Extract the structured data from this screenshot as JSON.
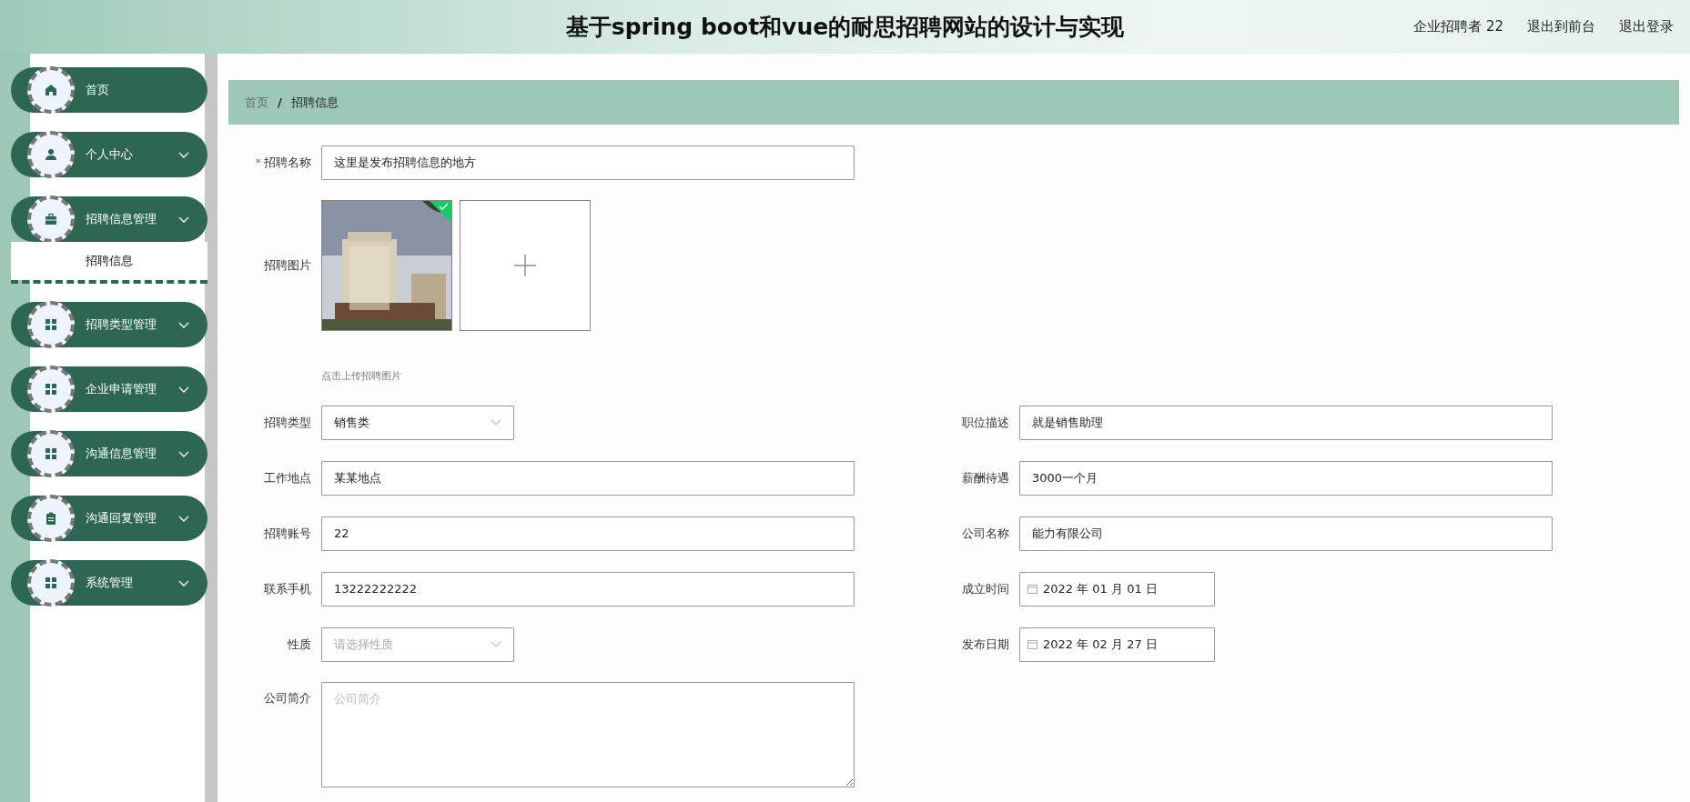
{
  "header": {
    "title": "基于spring boot和vue的耐思招聘网站的设计与实现",
    "links": [
      {
        "label": "企业招聘者 22"
      },
      {
        "label": "退出到前台"
      },
      {
        "label": "退出登录"
      }
    ]
  },
  "sidebar": {
    "items": [
      {
        "label": "首页",
        "kind": "link"
      },
      {
        "label": "个人中心",
        "kind": "menu"
      },
      {
        "label": "招聘信息管理",
        "kind": "menu",
        "children": [
          {
            "label": "招聘信息",
            "selected": true
          }
        ]
      },
      {
        "label": "招聘类型管理",
        "kind": "menu"
      },
      {
        "label": "企业申请管理",
        "kind": "menu"
      },
      {
        "label": "沟通信息管理",
        "kind": "menu"
      },
      {
        "label": "沟通回复管理",
        "kind": "menu"
      },
      {
        "label": "系统管理",
        "kind": "menu"
      }
    ]
  },
  "breadcrumb": {
    "separator": "/",
    "items": [
      {
        "label": "首页",
        "selected": false
      },
      {
        "label": "招聘信息",
        "selected": true
      }
    ]
  },
  "form": {
    "top_fields": [
      {
        "kind": "text",
        "label": "招聘名称",
        "required_mark": "*",
        "value": "这里是发布招聘信息的地方"
      },
      {
        "kind": "upload",
        "label": "招聘图片",
        "images": [
          {
            "kind": "picture",
            "uploaded": true
          }
        ],
        "hint": "点击上传招聘图片"
      }
    ],
    "grid_fields": [
      {
        "kind": "select",
        "label": "招聘类型",
        "value": "销售类"
      },
      {
        "kind": "text",
        "label": "职位描述",
        "value": "就是销售助理"
      },
      {
        "kind": "text",
        "label": "工作地点",
        "value": "某某地点"
      },
      {
        "kind": "text",
        "label": "薪酬待遇",
        "value": "3000一个月"
      },
      {
        "kind": "text",
        "label": "招聘账号",
        "value": "22"
      },
      {
        "kind": "text",
        "label": "公司名称",
        "value": "能力有限公司"
      },
      {
        "kind": "text",
        "label": "联系手机",
        "value": "13222222222"
      },
      {
        "kind": "date",
        "label": "成立时间",
        "value": "2022 年 01 月 01 日"
      },
      {
        "kind": "select",
        "label": "性质",
        "placeholder": "请选择性质"
      },
      {
        "kind": "date",
        "label": "发布日期",
        "value": "2022 年 02 月 27 日"
      }
    ],
    "bottom_fields": [
      {
        "kind": "textarea",
        "label": "公司简介",
        "placeholder": "公司简介"
      }
    ]
  }
}
